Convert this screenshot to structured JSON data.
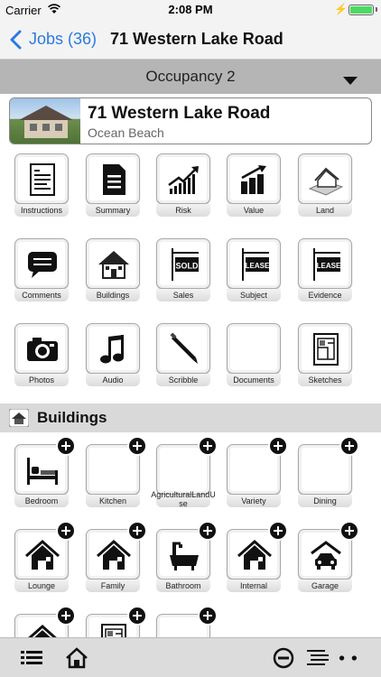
{
  "status_bar": {
    "carrier": "Carrier",
    "time": "2:08 PM",
    "battery_level": 1.0
  },
  "nav": {
    "back_label": "Jobs (36)",
    "title": "71 Western Lake Road"
  },
  "occupancy": {
    "selected": "Occupancy 2"
  },
  "property": {
    "title": "71 Western Lake Road",
    "subtitle": "Ocean Beach"
  },
  "job_tiles": [
    {
      "label": "Instructions",
      "icon": "instructions-document-icon"
    },
    {
      "label": "Summary",
      "icon": "summary-document-icon"
    },
    {
      "label": "Risk",
      "icon": "risk-chart-icon"
    },
    {
      "label": "Value",
      "icon": "value-bar-chart-icon"
    },
    {
      "label": "Land",
      "icon": "land-house-icon"
    },
    {
      "label": "Comments",
      "icon": "comment-bubble-icon"
    },
    {
      "label": "Buildings",
      "icon": "buildings-house-icon"
    },
    {
      "label": "Sales",
      "icon": "sold-sign-icon",
      "sign_text": "SOLD"
    },
    {
      "label": "Subject",
      "icon": "lease-sign-icon",
      "sign_text": "LEASE"
    },
    {
      "label": "Evidence",
      "icon": "lease-sign-icon",
      "sign_text": "LEASE"
    },
    {
      "label": "Photos",
      "icon": "camera-icon"
    },
    {
      "label": "Audio",
      "icon": "music-note-icon"
    },
    {
      "label": "Scribble",
      "icon": "pen-icon"
    },
    {
      "label": "Documents",
      "icon": "blank-document-icon"
    },
    {
      "label": "Sketches",
      "icon": "floor-plan-icon"
    }
  ],
  "buildings_section": {
    "title": "Buildings"
  },
  "building_tiles": [
    {
      "label": "Bedroom",
      "icon": "bed-icon"
    },
    {
      "label": "Kitchen",
      "icon": ""
    },
    {
      "label": "AgriculturalLandUse",
      "icon": ""
    },
    {
      "label": "Variety",
      "icon": ""
    },
    {
      "label": "Dining",
      "icon": ""
    },
    {
      "label": "Lounge",
      "icon": "house-icon"
    },
    {
      "label": "Family",
      "icon": "house-icon"
    },
    {
      "label": "Bathroom",
      "icon": "bathtub-icon"
    },
    {
      "label": "Internal",
      "icon": "house-icon"
    },
    {
      "label": "Garage",
      "icon": "garage-car-icon"
    },
    {
      "label": "",
      "icon": "house-icon"
    },
    {
      "label": "",
      "icon": "floor-plan-icon"
    },
    {
      "label": "",
      "icon": ""
    }
  ],
  "toolbar": {
    "items": [
      "list-icon",
      "home-icon",
      "minus-circle-icon",
      "outline-list-icon",
      "more-icon"
    ]
  },
  "colors": {
    "accent": "#2a7ae2",
    "battery": "#4cd964",
    "occupancy_bar": "#b5b5b5"
  }
}
